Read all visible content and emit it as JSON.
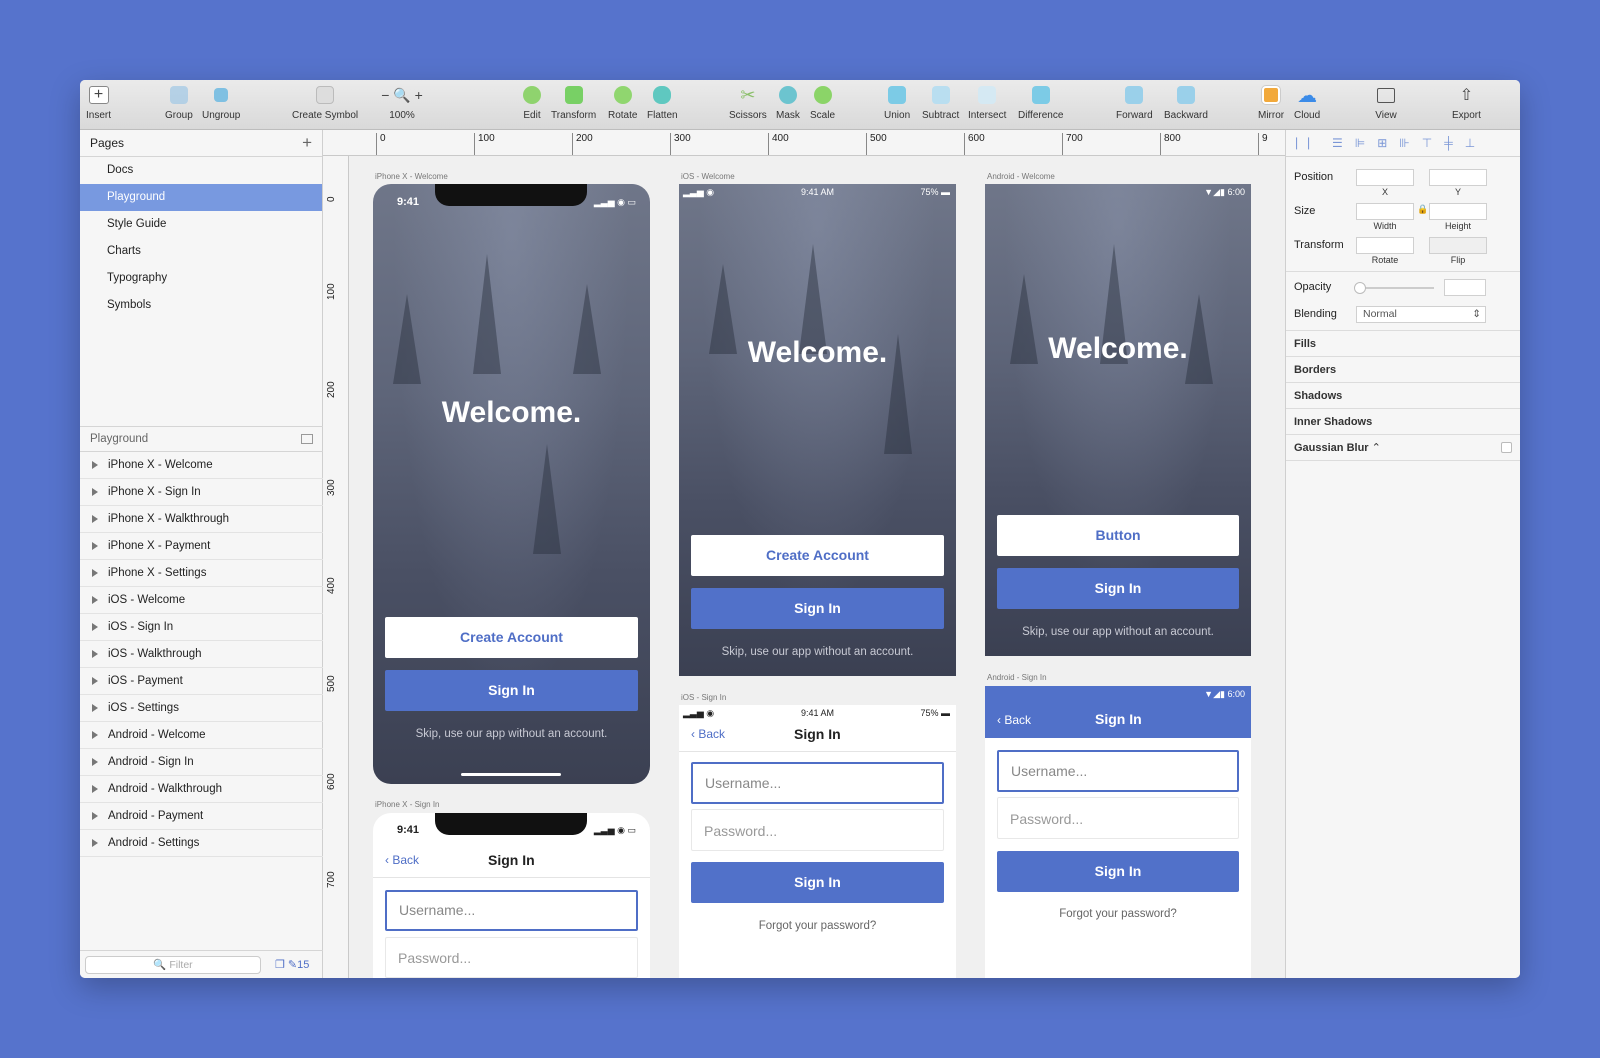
{
  "toolbar": {
    "insert": "Insert",
    "group": "Group",
    "ungroup": "Ungroup",
    "create_symbol": "Create Symbol",
    "zoom": "100%",
    "edit": "Edit",
    "transform": "Transform",
    "rotate": "Rotate",
    "flatten": "Flatten",
    "scissors": "Scissors",
    "mask": "Mask",
    "scale": "Scale",
    "union": "Union",
    "subtract": "Subtract",
    "intersect": "Intersect",
    "difference": "Difference",
    "forward": "Forward",
    "backward": "Backward",
    "mirror": "Mirror",
    "cloud": "Cloud",
    "view": "View",
    "export": "Export"
  },
  "pages": {
    "title": "Pages",
    "items": [
      "Docs",
      "Playground",
      "Style Guide",
      "Charts",
      "Typography",
      "Symbols"
    ],
    "selected": "Playground"
  },
  "layers": {
    "title": "Playground",
    "items": [
      "iPhone X - Welcome",
      "iPhone X - Sign In",
      "iPhone X - Walkthrough",
      "iPhone X - Payment",
      "iPhone X - Settings",
      "iOS - Welcome",
      "iOS - Sign In",
      "iOS - Walkthrough",
      "iOS - Payment",
      "iOS - Settings",
      "Android - Welcome",
      "Android - Sign In",
      "Android - Walkthrough",
      "Android - Payment",
      "Android - Settings"
    ],
    "filter_placeholder": "Filter",
    "count": "15"
  },
  "ruler": {
    "h": [
      "0",
      "100",
      "200",
      "300",
      "400",
      "500",
      "600",
      "700",
      "800",
      "9"
    ],
    "v": [
      "0",
      "100",
      "200",
      "300",
      "400",
      "500",
      "600",
      "700"
    ]
  },
  "inspector": {
    "position": "Position",
    "x": "X",
    "y": "Y",
    "size": "Size",
    "width": "Width",
    "height": "Height",
    "transform": "Transform",
    "rotate": "Rotate",
    "flip": "Flip",
    "opacity": "Opacity",
    "blending": "Blending",
    "blending_value": "Normal",
    "fills": "Fills",
    "borders": "Borders",
    "shadows": "Shadows",
    "inner_shadows": "Inner Shadows",
    "gaussian_blur": "Gaussian Blur"
  },
  "artboards": {
    "iphonex_welcome": {
      "label": "iPhone X - Welcome",
      "time": "9:41",
      "title": "Welcome.",
      "create": "Create Account",
      "signin": "Sign In",
      "skip": "Skip, use our app without an account."
    },
    "ios_welcome": {
      "label": "iOS - Welcome",
      "time": "9:41 AM",
      "battery": "75%",
      "title": "Welcome.",
      "create": "Create Account",
      "signin": "Sign In",
      "skip": "Skip, use our app without an account."
    },
    "android_welcome": {
      "label": "Android - Welcome",
      "time": "6:00",
      "title": "Welcome.",
      "button": "Button",
      "signin": "Sign In",
      "skip": "Skip, use our app without an account."
    },
    "iphonex_signin": {
      "label": "iPhone X - Sign In",
      "time": "9:41",
      "back": "Back",
      "title": "Sign In",
      "username": "Username...",
      "password": "Password..."
    },
    "ios_signin": {
      "label": "iOS - Sign In",
      "time": "9:41 AM",
      "battery": "75%",
      "back": "Back",
      "title": "Sign In",
      "username": "Username...",
      "password": "Password...",
      "signin": "Sign In",
      "forgot": "Forgot your password?"
    },
    "android_signin": {
      "label": "Android - Sign In",
      "time": "6:00",
      "back": "Back",
      "title": "Sign In",
      "username": "Username...",
      "password": "Password...",
      "signin": "Sign In",
      "forgot": "Forgot your password?"
    }
  }
}
